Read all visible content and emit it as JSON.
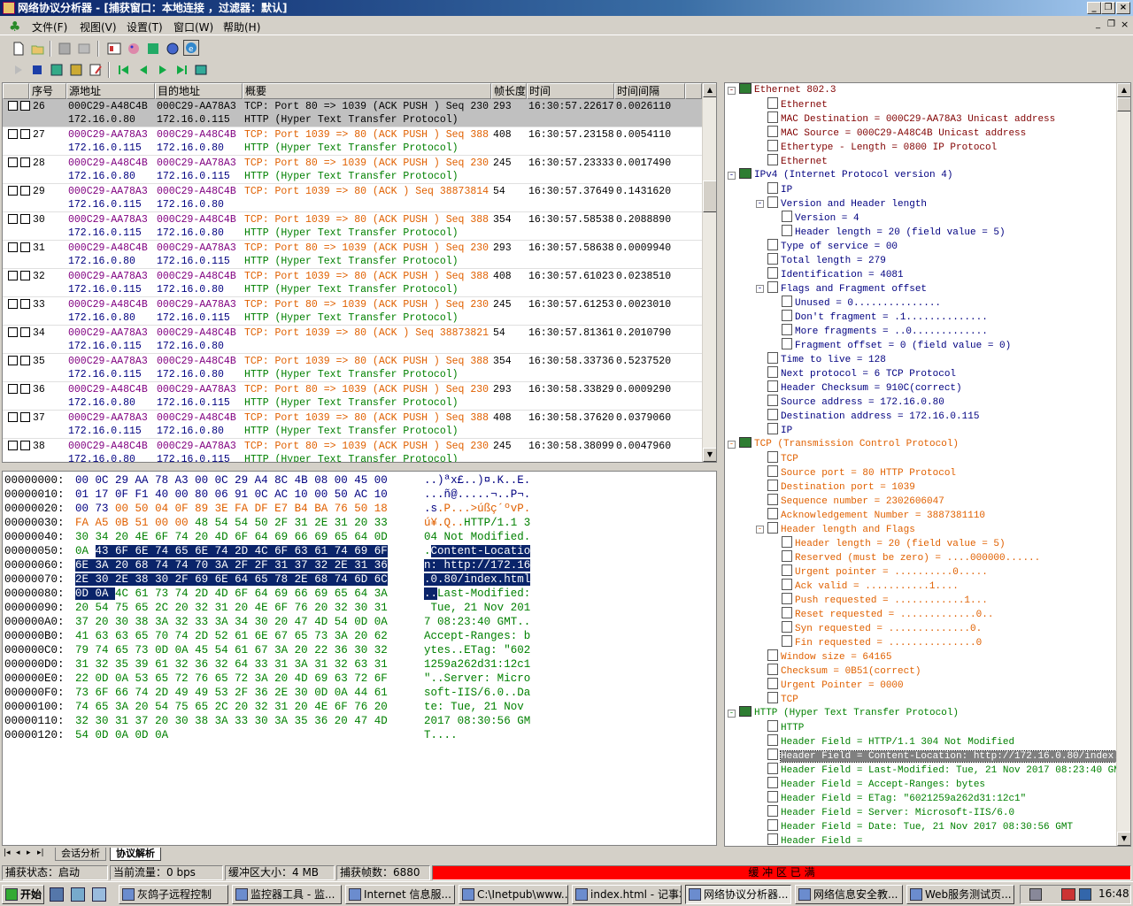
{
  "window": {
    "title": "网络协议分析器 - [捕获窗口：本地连接 ，过滤器：默认]"
  },
  "menu": [
    "文件(F)",
    "视图(V)",
    "设置(T)",
    "窗口(W)",
    "帮助(H)"
  ],
  "packet_table": {
    "headers": [
      "序号",
      "源地址",
      "目的地址",
      "概要",
      "帧长度",
      "时间",
      "时间间隔"
    ],
    "rows": [
      {
        "no": "26",
        "src": "000C29-A48C4B",
        "dst": "000C29-AA78A3",
        "src_ip": "172.16.0.80",
        "dst_ip": "172.16.0.115",
        "summary": "TCP: Port 80 => 1039 (ACK PUSH ) Seq 230",
        "proto": "HTTP (Hyper Text Transfer Protocol)",
        "len": "293",
        "time": "16:30:57.22617",
        "delta": "0.0026110"
      },
      {
        "no": "27",
        "src": "000C29-AA78A3",
        "dst": "000C29-A48C4B",
        "src_ip": "172.16.0.115",
        "dst_ip": "172.16.0.80",
        "summary": "TCP: Port 1039 => 80 (ACK PUSH ) Seq 388",
        "proto": "HTTP (Hyper Text Transfer Protocol)",
        "len": "408",
        "time": "16:30:57.23158",
        "delta": "0.0054110"
      },
      {
        "no": "28",
        "src": "000C29-A48C4B",
        "dst": "000C29-AA78A3",
        "src_ip": "172.16.0.80",
        "dst_ip": "172.16.0.115",
        "summary": "TCP: Port 80 => 1039 (ACK PUSH ) Seq 230",
        "proto": "HTTP (Hyper Text Transfer Protocol)",
        "len": "245",
        "time": "16:30:57.23333",
        "delta": "0.0017490"
      },
      {
        "no": "29",
        "src": "000C29-AA78A3",
        "dst": "000C29-A48C4B",
        "src_ip": "172.16.0.115",
        "dst_ip": "172.16.0.80",
        "summary": "TCP: Port 1039 => 80 (ACK ) Seq 38873814",
        "proto": "",
        "len": "54",
        "time": "16:30:57.37649",
        "delta": "0.1431620"
      },
      {
        "no": "30",
        "src": "000C29-AA78A3",
        "dst": "000C29-A48C4B",
        "src_ip": "172.16.0.115",
        "dst_ip": "172.16.0.80",
        "summary": "TCP: Port 1039 => 80 (ACK PUSH ) Seq 388",
        "proto": "HTTP (Hyper Text Transfer Protocol)",
        "len": "354",
        "time": "16:30:57.58538",
        "delta": "0.2088890"
      },
      {
        "no": "31",
        "src": "000C29-A48C4B",
        "dst": "000C29-AA78A3",
        "src_ip": "172.16.0.80",
        "dst_ip": "172.16.0.115",
        "summary": "TCP: Port 80 => 1039 (ACK PUSH ) Seq 230",
        "proto": "HTTP (Hyper Text Transfer Protocol)",
        "len": "293",
        "time": "16:30:57.58638",
        "delta": "0.0009940"
      },
      {
        "no": "32",
        "src": "000C29-AA78A3",
        "dst": "000C29-A48C4B",
        "src_ip": "172.16.0.115",
        "dst_ip": "172.16.0.80",
        "summary": "TCP: Port 1039 => 80 (ACK PUSH ) Seq 388",
        "proto": "HTTP (Hyper Text Transfer Protocol)",
        "len": "408",
        "time": "16:30:57.61023",
        "delta": "0.0238510"
      },
      {
        "no": "33",
        "src": "000C29-A48C4B",
        "dst": "000C29-AA78A3",
        "src_ip": "172.16.0.80",
        "dst_ip": "172.16.0.115",
        "summary": "TCP: Port 80 => 1039 (ACK PUSH ) Seq 230",
        "proto": "HTTP (Hyper Text Transfer Protocol)",
        "len": "245",
        "time": "16:30:57.61253",
        "delta": "0.0023010"
      },
      {
        "no": "34",
        "src": "000C29-AA78A3",
        "dst": "000C29-A48C4B",
        "src_ip": "172.16.0.115",
        "dst_ip": "172.16.0.80",
        "summary": "TCP: Port 1039 => 80 (ACK ) Seq 38873821",
        "proto": "",
        "len": "54",
        "time": "16:30:57.81361",
        "delta": "0.2010790"
      },
      {
        "no": "35",
        "src": "000C29-AA78A3",
        "dst": "000C29-A48C4B",
        "src_ip": "172.16.0.115",
        "dst_ip": "172.16.0.80",
        "summary": "TCP: Port 1039 => 80 (ACK PUSH ) Seq 388",
        "proto": "HTTP (Hyper Text Transfer Protocol)",
        "len": "354",
        "time": "16:30:58.33736",
        "delta": "0.5237520"
      },
      {
        "no": "36",
        "src": "000C29-A48C4B",
        "dst": "000C29-AA78A3",
        "src_ip": "172.16.0.80",
        "dst_ip": "172.16.0.115",
        "summary": "TCP: Port 80 => 1039 (ACK PUSH ) Seq 230",
        "proto": "HTTP (Hyper Text Transfer Protocol)",
        "len": "293",
        "time": "16:30:58.33829",
        "delta": "0.0009290"
      },
      {
        "no": "37",
        "src": "000C29-AA78A3",
        "dst": "000C29-A48C4B",
        "src_ip": "172.16.0.115",
        "dst_ip": "172.16.0.80",
        "summary": "TCP: Port 1039 => 80 (ACK PUSH ) Seq 388",
        "proto": "HTTP (Hyper Text Transfer Protocol)",
        "len": "408",
        "time": "16:30:58.37620",
        "delta": "0.0379060"
      },
      {
        "no": "38",
        "src": "000C29-A48C4B",
        "dst": "000C29-AA78A3",
        "src_ip": "172.16.0.80",
        "dst_ip": "172.16.0.115",
        "summary": "TCP: Port 80 => 1039 (ACK PUSH ) Seq 230",
        "proto": "HTTP (Hyper Text Transfer Protocol)",
        "len": "245",
        "time": "16:30:58.38099",
        "delta": "0.0047960"
      }
    ]
  },
  "hex_dump": [
    {
      "off": "00000000:",
      "hex": "00 0C 29 AA 78 A3 00 0C 29 A4 8C 4B 08 00 45 00",
      "ascii": "..)ªx£..)¤.K..E."
    },
    {
      "off": "00000010:",
      "hex": "01 17 0F F1 40 00 80 06 91 0C AC 10 00 50 AC 10",
      "ascii": "...ñ@.....¬..P¬."
    },
    {
      "off": "00000020:",
      "hex": "00 73 00 50 04 0F 89 3E FA DF E7 B4 BA 76 50 18",
      "ascii": ".s.P...>úßç´ºvP."
    },
    {
      "off": "00000030:",
      "hex": "FA A5 0B 51 00 00 48 54 54 50 2F 31 2E 31 20 33",
      "ascii": "ú¥.Q..HTTP/1.1 3"
    },
    {
      "off": "00000040:",
      "hex": "30 34 20 4E 6F 74 20 4D 6F 64 69 66 69 65 64 0D",
      "ascii": "04 Not Modified."
    },
    {
      "off": "00000050:",
      "hex": "0A 43 6F 6E 74 65 6E 74 2D 4C 6F 63 61 74 69 6F",
      "ascii": ".Content-Locatio"
    },
    {
      "off": "00000060:",
      "hex": "6E 3A 20 68 74 74 70 3A 2F 2F 31 37 32 2E 31 36",
      "ascii": "n: http://172.16"
    },
    {
      "off": "00000070:",
      "hex": "2E 30 2E 38 30 2F 69 6E 64 65 78 2E 68 74 6D 6C",
      "ascii": ".0.80/index.html"
    },
    {
      "off": "00000080:",
      "hex": "0D 0A 4C 61 73 74 2D 4D 6F 64 69 66 69 65 64 3A",
      "ascii": "..Last-Modified:"
    },
    {
      "off": "00000090:",
      "hex": "20 54 75 65 2C 20 32 31 20 4E 6F 76 20 32 30 31",
      "ascii": " Tue, 21 Nov 201"
    },
    {
      "off": "000000A0:",
      "hex": "37 20 30 38 3A 32 33 3A 34 30 20 47 4D 54 0D 0A",
      "ascii": "7 08:23:40 GMT.."
    },
    {
      "off": "000000B0:",
      "hex": "41 63 63 65 70 74 2D 52 61 6E 67 65 73 3A 20 62",
      "ascii": "Accept-Ranges: b"
    },
    {
      "off": "000000C0:",
      "hex": "79 74 65 73 0D 0A 45 54 61 67 3A 20 22 36 30 32",
      "ascii": "ytes..ETag: \"602"
    },
    {
      "off": "000000D0:",
      "hex": "31 32 35 39 61 32 36 32 64 33 31 3A 31 32 63 31",
      "ascii": "1259a262d31:12c1"
    },
    {
      "off": "000000E0:",
      "hex": "22 0D 0A 53 65 72 76 65 72 3A 20 4D 69 63 72 6F",
      "ascii": "\"..Server: Micro"
    },
    {
      "off": "000000F0:",
      "hex": "73 6F 66 74 2D 49 49 53 2F 36 2E 30 0D 0A 44 61",
      "ascii": "soft-IIS/6.0..Da"
    },
    {
      "off": "00000100:",
      "hex": "74 65 3A 20 54 75 65 2C 20 32 31 20 4E 6F 76 20",
      "ascii": "te: Tue, 21 Nov "
    },
    {
      "off": "00000110:",
      "hex": "32 30 31 37 20 30 38 3A 33 30 3A 35 36 20 47 4D",
      "ascii": "2017 08:30:56 GM"
    },
    {
      "off": "00000120:",
      "hex": "54 0D 0A 0D 0A",
      "ascii": "T...."
    }
  ],
  "tree": [
    {
      "lvl": 0,
      "t": "Ethernet 802.3",
      "c": "#800000",
      "exp": "-",
      "book": true
    },
    {
      "lvl": 1,
      "t": "Ethernet",
      "c": "#800000"
    },
    {
      "lvl": 1,
      "t": "MAC Destination = 000C29-AA78A3 Unicast address",
      "c": "#800000"
    },
    {
      "lvl": 1,
      "t": "MAC Source = 000C29-A48C4B Unicast address",
      "c": "#800000"
    },
    {
      "lvl": 1,
      "t": "Ethertype - Length = 0800 IP Protocol",
      "c": "#800000"
    },
    {
      "lvl": 1,
      "t": "Ethernet",
      "c": "#800000"
    },
    {
      "lvl": 0,
      "t": "IPv4 (Internet Protocol version 4)",
      "c": "#000080",
      "exp": "-",
      "book": true
    },
    {
      "lvl": 1,
      "t": "IP",
      "c": "#000080"
    },
    {
      "lvl": 1,
      "t": "Version and Header length",
      "c": "#000080",
      "exp": "-"
    },
    {
      "lvl": 2,
      "t": "Version = 4",
      "c": "#000080"
    },
    {
      "lvl": 2,
      "t": "Header length = 20 (field value = 5)",
      "c": "#000080"
    },
    {
      "lvl": 1,
      "t": "Type of service = 00",
      "c": "#000080"
    },
    {
      "lvl": 1,
      "t": "Total length = 279",
      "c": "#000080"
    },
    {
      "lvl": 1,
      "t": "Identification = 4081",
      "c": "#000080"
    },
    {
      "lvl": 1,
      "t": "Flags and Fragment offset",
      "c": "#000080",
      "exp": "-"
    },
    {
      "lvl": 2,
      "t": "Unused = 0...............",
      "c": "#000080"
    },
    {
      "lvl": 2,
      "t": "Don't fragment = .1..............",
      "c": "#000080"
    },
    {
      "lvl": 2,
      "t": "More fragments = ..0.............",
      "c": "#000080"
    },
    {
      "lvl": 2,
      "t": "Fragment offset = 0 (field value = 0)",
      "c": "#000080"
    },
    {
      "lvl": 1,
      "t": "Time to live = 128",
      "c": "#000080"
    },
    {
      "lvl": 1,
      "t": "Next protocol = 6 TCP Protocol",
      "c": "#000080"
    },
    {
      "lvl": 1,
      "t": "Header Checksum = 910C(correct)",
      "c": "#000080"
    },
    {
      "lvl": 1,
      "t": "Source address = 172.16.0.80",
      "c": "#000080"
    },
    {
      "lvl": 1,
      "t": "Destination address = 172.16.0.115",
      "c": "#000080"
    },
    {
      "lvl": 1,
      "t": "IP",
      "c": "#000080"
    },
    {
      "lvl": 0,
      "t": "TCP (Transmission Control Protocol)",
      "c": "#e06000",
      "exp": "-",
      "book": true
    },
    {
      "lvl": 1,
      "t": "TCP",
      "c": "#e06000"
    },
    {
      "lvl": 1,
      "t": "Source port = 80 HTTP Protocol",
      "c": "#e06000"
    },
    {
      "lvl": 1,
      "t": "Destination port = 1039",
      "c": "#e06000"
    },
    {
      "lvl": 1,
      "t": "Sequence number = 2302606047",
      "c": "#e06000"
    },
    {
      "lvl": 1,
      "t": "Acknowledgement Number = 3887381110",
      "c": "#e06000"
    },
    {
      "lvl": 1,
      "t": "Header length and Flags",
      "c": "#e06000",
      "exp": "-"
    },
    {
      "lvl": 2,
      "t": "Header length = 20 (field value = 5)",
      "c": "#e06000"
    },
    {
      "lvl": 2,
      "t": "Reserved (must be zero) = ....000000......",
      "c": "#e06000"
    },
    {
      "lvl": 2,
      "t": "Urgent pointer = ..........0.....",
      "c": "#e06000"
    },
    {
      "lvl": 2,
      "t": "Ack valid = ...........1....",
      "c": "#e06000"
    },
    {
      "lvl": 2,
      "t": "Push requested = ............1...",
      "c": "#e06000"
    },
    {
      "lvl": 2,
      "t": "Reset requested = .............0..",
      "c": "#e06000"
    },
    {
      "lvl": 2,
      "t": "Syn requested = ..............0.",
      "c": "#e06000"
    },
    {
      "lvl": 2,
      "t": "Fin requested = ...............0",
      "c": "#e06000"
    },
    {
      "lvl": 1,
      "t": "Window size = 64165",
      "c": "#e06000"
    },
    {
      "lvl": 1,
      "t": "Checksum = 0B51(correct)",
      "c": "#e06000"
    },
    {
      "lvl": 1,
      "t": "Urgent Pointer = 0000",
      "c": "#e06000"
    },
    {
      "lvl": 1,
      "t": "TCP",
      "c": "#e06000"
    },
    {
      "lvl": 0,
      "t": "HTTP (Hyper Text Transfer Protocol)",
      "c": "#008000",
      "exp": "-",
      "book": true
    },
    {
      "lvl": 1,
      "t": "HTTP",
      "c": "#008000"
    },
    {
      "lvl": 1,
      "t": "Header Field = HTTP/1.1 304 Not Modified",
      "c": "#008000"
    },
    {
      "lvl": 1,
      "t": "Header Field = Content-Location: http://172.16.0.80/index.html",
      "c": "#008000",
      "sel": true
    },
    {
      "lvl": 1,
      "t": "Header Field = Last-Modified: Tue, 21 Nov 2017 08:23:40 GMT",
      "c": "#008000"
    },
    {
      "lvl": 1,
      "t": "Header Field = Accept-Ranges: bytes",
      "c": "#008000"
    },
    {
      "lvl": 1,
      "t": "Header Field = ETag: \"6021259a262d31:12c1\"",
      "c": "#008000"
    },
    {
      "lvl": 1,
      "t": "Header Field = Server: Microsoft-IIS/6.0",
      "c": "#008000"
    },
    {
      "lvl": 1,
      "t": "Header Field = Date: Tue, 21 Nov 2017 08:30:56 GMT",
      "c": "#008000"
    },
    {
      "lvl": 1,
      "t": "Header Field =",
      "c": "#008000"
    }
  ],
  "tabs": [
    "会话分析",
    "协议解析"
  ],
  "status": {
    "capture": "捕获状态：启动",
    "flow": "当前流量：0 bps",
    "buffer": "缓冲区大小：4 MB",
    "frames": "捕获帧数：6880",
    "alert": "缓 冲 区 已 满"
  },
  "taskbar": {
    "start": "开始",
    "items": [
      "灰鸽子远程控制",
      "监控器工具 - 监...",
      "Internet 信息服...",
      "C:\\Inetpub\\www...",
      "index.html - 记事本",
      "网络协议分析器...",
      "网络信息安全教...",
      "Web服务测试页..."
    ],
    "clock": "16:48"
  },
  "colors": {
    "tcp_src80": "#000000",
    "tcp_orange": "#e06000",
    "http_green": "#008000",
    "addr_purple": "#800080",
    "selected_row": "#c0c0c0",
    "highlight": "#0a246a",
    "alert_red": "#ff0000"
  }
}
